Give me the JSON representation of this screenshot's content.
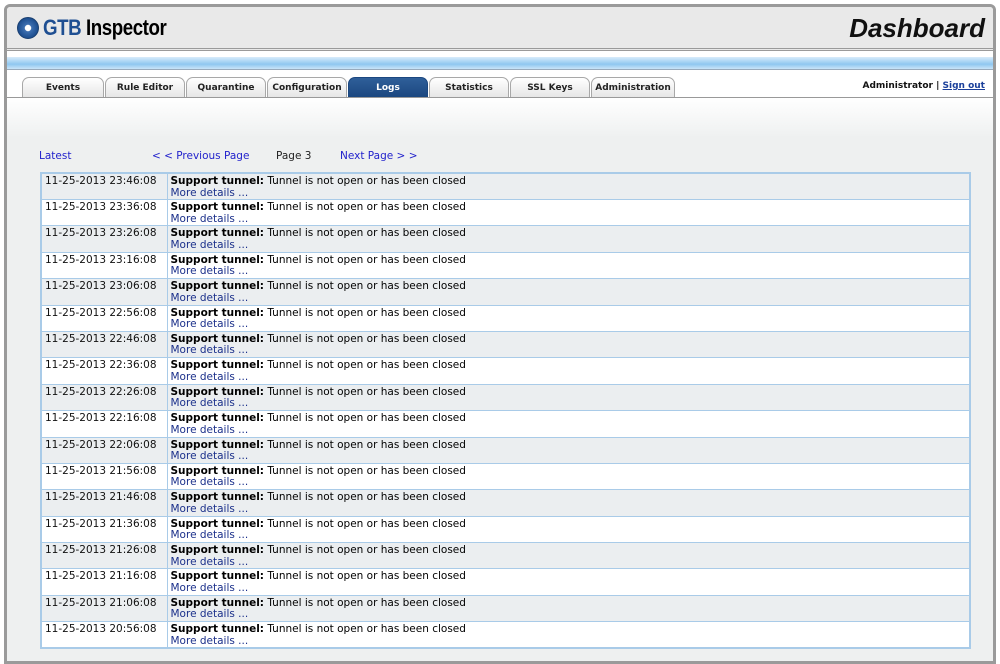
{
  "header": {
    "logo_text_a": "GTB",
    "logo_text_b": " Inspector",
    "title": "Dashboard"
  },
  "tabs": [
    {
      "label": "Events",
      "w": 82
    },
    {
      "label": "Rule Editor",
      "w": 80
    },
    {
      "label": "Quarantine",
      "w": 80
    },
    {
      "label": "Configuration",
      "w": 80
    },
    {
      "label": "Logs",
      "w": 80,
      "active": true
    },
    {
      "label": "Statistics",
      "w": 80
    },
    {
      "label": "SSL Keys",
      "w": 80
    },
    {
      "label": "Administration",
      "w": 84
    }
  ],
  "user": {
    "name": "Administrator",
    "separator": "|",
    "sign_out": "Sign out"
  },
  "pager": {
    "latest": "Latest",
    "previous": "< < Previous Page",
    "page": "Page 3",
    "next": "Next Page > >"
  },
  "log_rows": [
    {
      "time": "11-25-2013 23:46:08"
    },
    {
      "time": "11-25-2013 23:36:08"
    },
    {
      "time": "11-25-2013 23:26:08"
    },
    {
      "time": "11-25-2013 23:16:08"
    },
    {
      "time": "11-25-2013 23:06:08"
    },
    {
      "time": "11-25-2013 22:56:08"
    },
    {
      "time": "11-25-2013 22:46:08"
    },
    {
      "time": "11-25-2013 22:36:08"
    },
    {
      "time": "11-25-2013 22:26:08"
    },
    {
      "time": "11-25-2013 22:16:08"
    },
    {
      "time": "11-25-2013 22:06:08"
    },
    {
      "time": "11-25-2013 21:56:08"
    },
    {
      "time": "11-25-2013 21:46:08"
    },
    {
      "time": "11-25-2013 21:36:08"
    },
    {
      "time": "11-25-2013 21:26:08"
    },
    {
      "time": "11-25-2013 21:16:08"
    },
    {
      "time": "11-25-2013 21:06:08"
    },
    {
      "time": "11-25-2013 20:56:08"
    }
  ],
  "log_entry": {
    "source": "Support tunnel:",
    "message": " Tunnel is not open or has been closed",
    "more": "More details ..."
  }
}
